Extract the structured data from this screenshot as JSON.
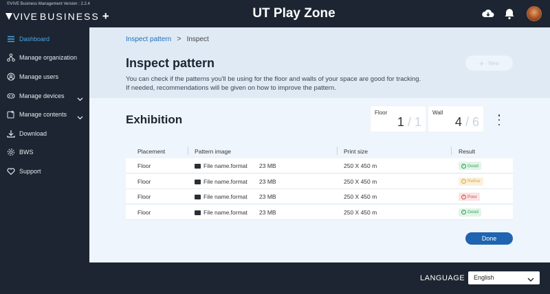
{
  "app": {
    "version_text": "©VIVE Business Management Version : 2.2.4",
    "logo_vive": "VIVE",
    "logo_business": "BUSINESS",
    "logo_plus": "+",
    "title": "UT Play Zone"
  },
  "sidebar": {
    "items": [
      {
        "label": "Dashboard",
        "icon": "menu-icon"
      },
      {
        "label": "Manage organization",
        "icon": "org-icon"
      },
      {
        "label": "Manage users",
        "icon": "user-icon"
      },
      {
        "label": "Manage devices",
        "icon": "device-icon"
      },
      {
        "label": "Manage contents",
        "icon": "content-icon"
      },
      {
        "label": "Download",
        "icon": "download-icon"
      },
      {
        "label": "BWS",
        "icon": "gear-icon"
      },
      {
        "label": "Support",
        "icon": "heart-icon"
      }
    ]
  },
  "breadcrumb": {
    "link": "Inspect pattern",
    "separator": ">",
    "current": "Inspect"
  },
  "page": {
    "title": "Inspect pattern",
    "description_line1": "You can check if the patterns you'll be using for the floor and walls of your space are good for tracking.",
    "description_line2": "If needed, recommendations will be given on how to improve the pattern.",
    "new_button": "New",
    "new_button_plus": "+"
  },
  "section": {
    "title": "Exhibition",
    "floor": {
      "label": "Floor",
      "value": "1",
      "sep": "/",
      "total": "1"
    },
    "wall": {
      "label": "Wall",
      "value": "4",
      "sep": "/",
      "total": "6"
    }
  },
  "table": {
    "headers": {
      "placement": "Placement",
      "pattern_image": "Pattern image",
      "print_size": "Print size",
      "result": "Result"
    },
    "rows": [
      {
        "placement": "Floor",
        "file": "File name.format",
        "size": "23 MB",
        "print": "250 X 450 m",
        "result": "Good",
        "status": "good"
      },
      {
        "placement": "Floor",
        "file": "File name.format",
        "size": "23 MB",
        "print": "250 X 450 m",
        "result": "Refine",
        "status": "refine"
      },
      {
        "placement": "Floor",
        "file": "File name.format",
        "size": "23 MB",
        "print": "250 X 450 m",
        "result": "Poor",
        "status": "poor"
      },
      {
        "placement": "Floor",
        "file": "File name.format",
        "size": "23 MB",
        "print": "250 X 450 m",
        "result": "Good",
        "status": "good"
      }
    ]
  },
  "done_button": "Done",
  "footer": {
    "language_label": "LANGUAGE",
    "language_value": "English"
  },
  "colors": {
    "accent": "#1e64b0",
    "active_nav": "#4aa6e8",
    "good": "#2e9e5a",
    "refine": "#d8a43a",
    "poor": "#d94a4a"
  }
}
